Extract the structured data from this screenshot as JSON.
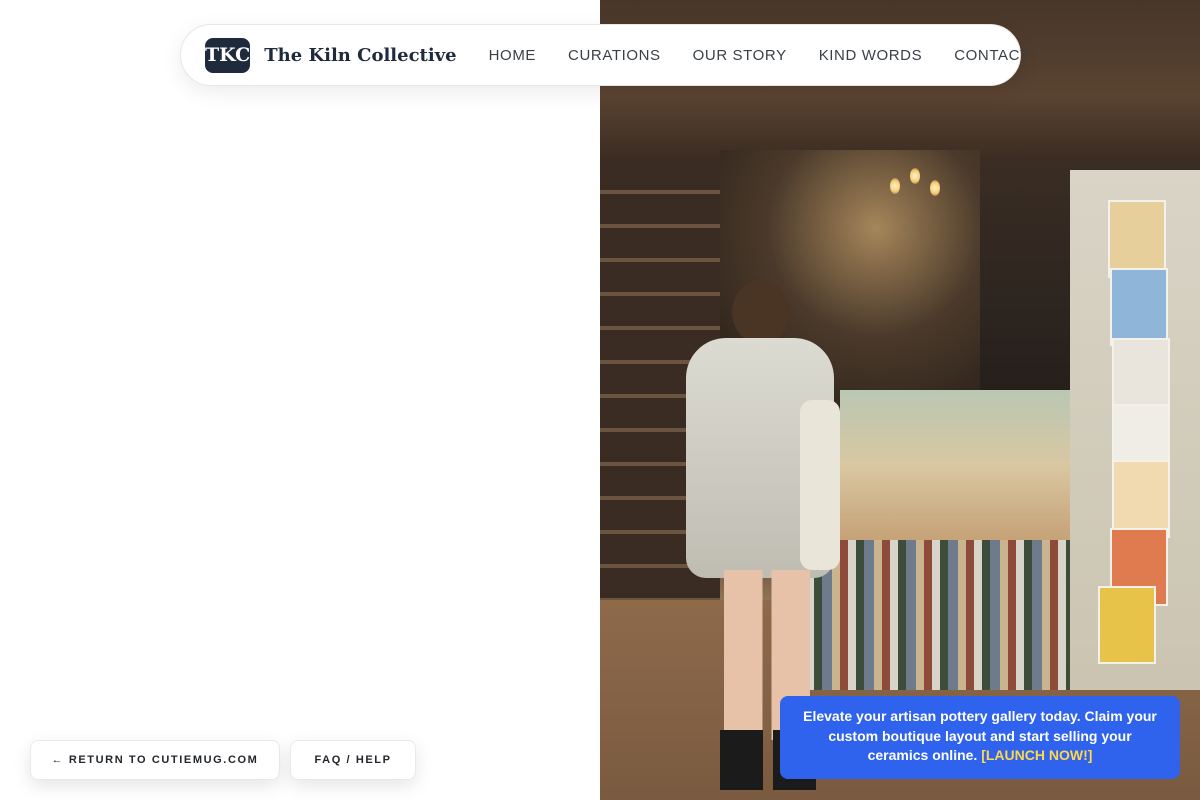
{
  "nav": {
    "logo_badge": "TKC",
    "brand_name": "The Kiln Collective",
    "items": [
      {
        "label": "HOME"
      },
      {
        "label": "CURATIONS"
      },
      {
        "label": "OUR STORY"
      },
      {
        "label": "KIND WORDS"
      },
      {
        "label": "CONTACT"
      }
    ]
  },
  "hero": {
    "image_subject": "woman browsing postcards and books in a crowded bookshop"
  },
  "footer_buttons": {
    "return_label": "← RETURN TO CUTIEMUG.COM",
    "faq_label": "FAQ / HELP"
  },
  "promo": {
    "text": "Elevate your artisan pottery gallery today. Claim your custom boutique layout and start selling your ceramics online.",
    "cta": "[LAUNCH NOW!]"
  },
  "colors": {
    "navy": "#1f2a3c",
    "promo_blue": "#2f63ee",
    "cta_yellow": "#ffd84a"
  }
}
